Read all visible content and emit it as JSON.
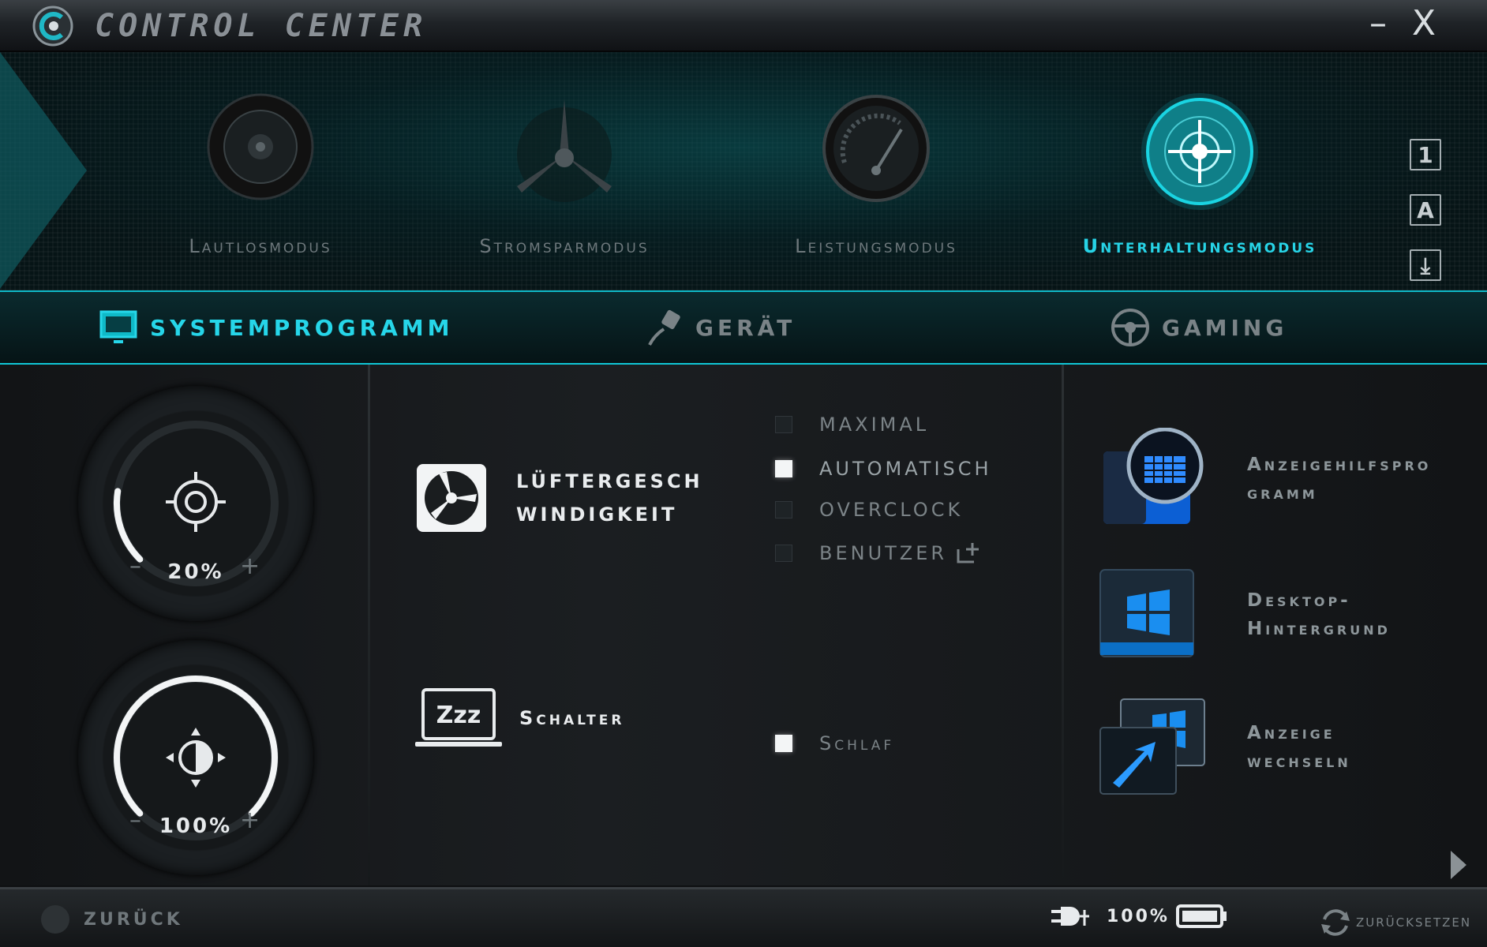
{
  "window": {
    "title": "Control Center",
    "minimize_label": "–",
    "close_label": "X"
  },
  "modes": [
    {
      "label": "Lautlosmodus",
      "icon": "speaker-icon",
      "active": false
    },
    {
      "label": "Stromsparmodus",
      "icon": "fan-blade-icon",
      "active": false
    },
    {
      "label": "Leistungsmodus",
      "icon": "gauge-icon",
      "active": false
    },
    {
      "label": "Unterhaltungsmodus",
      "icon": "radar-crosshair-icon",
      "active": true
    }
  ],
  "side_icons": [
    {
      "label": "1",
      "icon": "number-one-icon"
    },
    {
      "label": "A",
      "icon": "caps-lock-icon"
    },
    {
      "label": "⤓",
      "icon": "scroll-lock-icon"
    },
    {
      "label": "✈",
      "icon": "airplane-mode-icon"
    }
  ],
  "tabs": [
    {
      "label": "SYSTEMPROGRAMM",
      "icon": "monitor-icon",
      "active": true
    },
    {
      "label": "GERÄT",
      "icon": "plug-icon",
      "active": false
    },
    {
      "label": "GAMING",
      "icon": "steering-wheel-icon",
      "active": false
    }
  ],
  "dials": {
    "volume": {
      "value": "20%",
      "level": 20,
      "minus": "–",
      "plus": "+",
      "icon": "speaker-target-icon"
    },
    "brightness": {
      "value": "100%",
      "level": 100,
      "minus": "–",
      "plus": "+",
      "icon": "brightness-icon"
    }
  },
  "fan": {
    "label_line1": "LÜFTERGESCH",
    "label_line2": "WINDIGKEIT",
    "options": [
      {
        "label": "MAXIMAL",
        "checked": false
      },
      {
        "label": "AUTOMATISCH",
        "checked": true
      },
      {
        "label": "OVERCLOCK",
        "checked": false
      },
      {
        "label": "BENUTZER",
        "checked": false
      }
    ]
  },
  "switch": {
    "label": "Schalter",
    "icon_text": "Zzz",
    "option": {
      "label": "Schlaf",
      "checked": true
    }
  },
  "apps": [
    {
      "label_line1": "Anzeigehilfspro",
      "label_line2": "gramm",
      "icon": "display-grid-icon"
    },
    {
      "label_line1": "Desktop-",
      "label_line2": "Hintergrund",
      "icon": "windows-wallpaper-icon"
    },
    {
      "label_line1": "Anzeige",
      "label_line2": "wechseln",
      "icon": "display-switch-icon"
    }
  ],
  "footer": {
    "back_label": "ZURÜCK",
    "battery_percent": "100%",
    "reset_label": "ZURÜCKSETZEN"
  },
  "colors": {
    "accent": "#26d6e9",
    "background": "#121416"
  }
}
